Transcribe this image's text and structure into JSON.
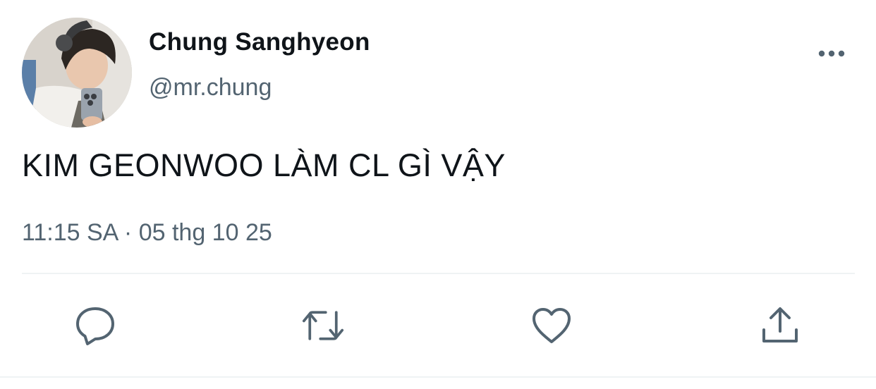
{
  "author": {
    "display_name": "Chung Sanghyeon",
    "handle": "@mr.chung",
    "avatar_icon": "profile-photo"
  },
  "tweet": {
    "text": "KIM GEONWOO LÀM CL GÌ VẬY",
    "timestamp": "11:15 SA · 05 thg 10 25"
  },
  "actions": [
    {
      "name": "reply",
      "icon": "speech-bubble-icon"
    },
    {
      "name": "retweet",
      "icon": "retweet-arrows-icon"
    },
    {
      "name": "like",
      "icon": "heart-icon"
    },
    {
      "name": "share",
      "icon": "share-upload-icon"
    }
  ],
  "menu": {
    "icon": "more-horizontal-icon"
  },
  "colors": {
    "text_primary": "#0f1419",
    "text_secondary": "#536471",
    "icon": "#536471",
    "divider": "#eff3f4",
    "background": "#ffffff"
  }
}
